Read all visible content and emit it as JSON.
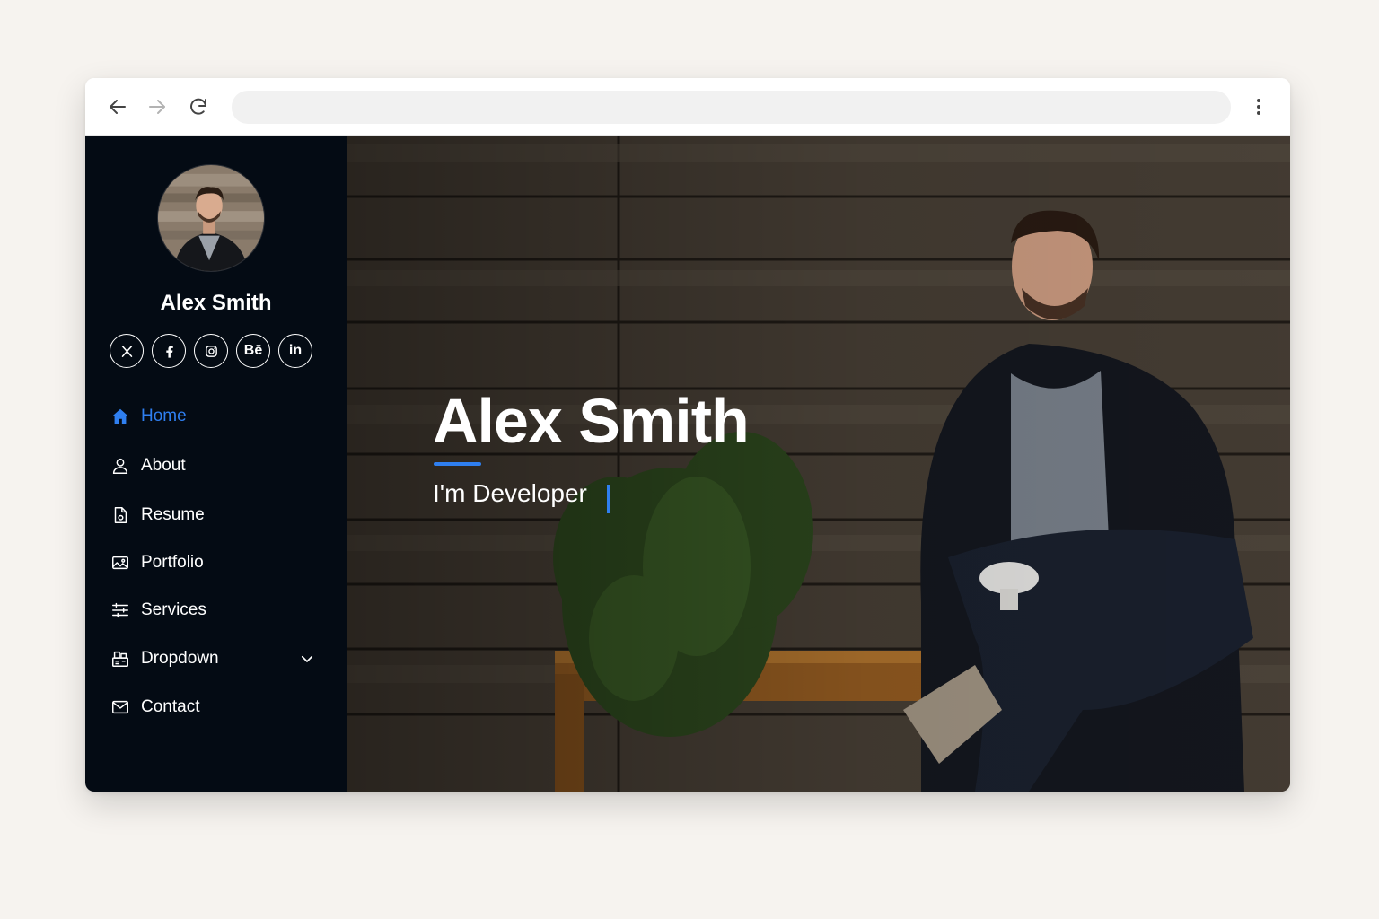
{
  "browser": {
    "address_value": "",
    "icons": [
      "back-arrow-icon",
      "forward-arrow-icon",
      "reload-icon",
      "more-vertical-icon"
    ]
  },
  "sidebar": {
    "profile_name": "Alex Smith",
    "socials": [
      {
        "icon": "x-twitter-icon",
        "text": ""
      },
      {
        "icon": "facebook-icon",
        "text": ""
      },
      {
        "icon": "instagram-icon",
        "text": ""
      },
      {
        "icon": "behance-icon",
        "text": "Bē"
      },
      {
        "icon": "linkedin-icon",
        "text": "in"
      }
    ],
    "nav": [
      {
        "label": "Home",
        "icon": "home-icon",
        "active": true
      },
      {
        "label": "About",
        "icon": "person-icon"
      },
      {
        "label": "Resume",
        "icon": "file-icon"
      },
      {
        "label": "Portfolio",
        "icon": "image-icon"
      },
      {
        "label": "Services",
        "icon": "sliders-icon"
      },
      {
        "label": "Dropdown",
        "icon": "menu-icon",
        "has_chevron": true
      },
      {
        "label": "Contact",
        "icon": "envelope-icon"
      }
    ]
  },
  "hero": {
    "title": "Alex Smith",
    "subtitle": "I'm Developer"
  },
  "colors": {
    "accent": "#2f7ff0",
    "sidebar_bg": "#040b14",
    "page_bg": "#f6f3ef"
  }
}
